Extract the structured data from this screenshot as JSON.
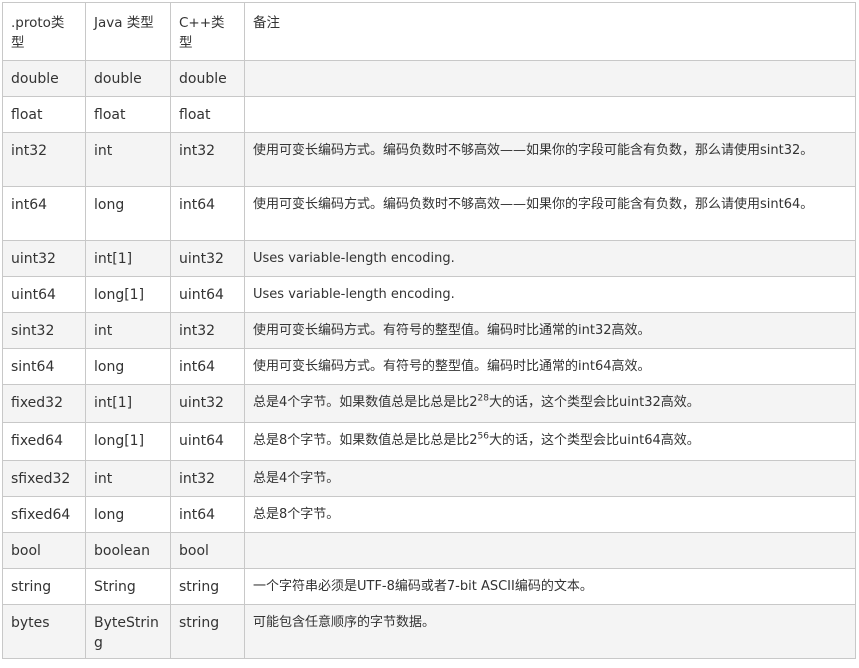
{
  "headers": {
    "proto": ".proto类型",
    "java": "Java 类型",
    "cpp": "C++类型",
    "note": "备注"
  },
  "rows": [
    {
      "proto": "double",
      "java": "double",
      "cpp": "double",
      "note": ""
    },
    {
      "proto": "float",
      "java": "float",
      "cpp": "float",
      "note": ""
    },
    {
      "proto": "int32",
      "java": "int",
      "cpp": "int32",
      "note": "使用可变长编码方式。编码负数时不够高效——如果你的字段可能含有负数，那么请使用sint32。"
    },
    {
      "proto": "int64",
      "java": "long",
      "cpp": "int64",
      "note": "使用可变长编码方式。编码负数时不够高效——如果你的字段可能含有负数，那么请使用sint64。"
    },
    {
      "proto": "uint32",
      "java": "int[1]",
      "cpp": "uint32",
      "note": "Uses variable-length encoding."
    },
    {
      "proto": "uint64",
      "java": "long[1]",
      "cpp": "uint64",
      "note": "Uses variable-length encoding."
    },
    {
      "proto": "sint32",
      "java": "int",
      "cpp": "int32",
      "note": "使用可变长编码方式。有符号的整型值。编码时比通常的int32高效。"
    },
    {
      "proto": "sint64",
      "java": "long",
      "cpp": "int64",
      "note": "使用可变长编码方式。有符号的整型值。编码时比通常的int64高效。"
    },
    {
      "proto": "fixed32",
      "java": "int[1]",
      "cpp": "uint32",
      "note_pre": "总是4个字节。如果数值总是比总是比2",
      "note_sup": "28",
      "note_post": "大的话，这个类型会比uint32高效。"
    },
    {
      "proto": "fixed64",
      "java": "long[1]",
      "cpp": "uint64",
      "note_pre": "总是8个字节。如果数值总是比总是比2",
      "note_sup": "56",
      "note_post": "大的话，这个类型会比uint64高效。"
    },
    {
      "proto": "sfixed32",
      "java": "int",
      "cpp": "int32",
      "note": "总是4个字节。"
    },
    {
      "proto": "sfixed64",
      "java": "long",
      "cpp": "int64",
      "note": "总是8个字节。"
    },
    {
      "proto": "bool",
      "java": "boolean",
      "cpp": "bool",
      "note": ""
    },
    {
      "proto": "string",
      "java": "String",
      "cpp": "string",
      "note": "一个字符串必须是UTF-8编码或者7-bit ASCII编码的文本。"
    },
    {
      "proto": "bytes",
      "java": "ByteString",
      "cpp": "string",
      "note": "可能包含任意顺序的字节数据。"
    }
  ]
}
